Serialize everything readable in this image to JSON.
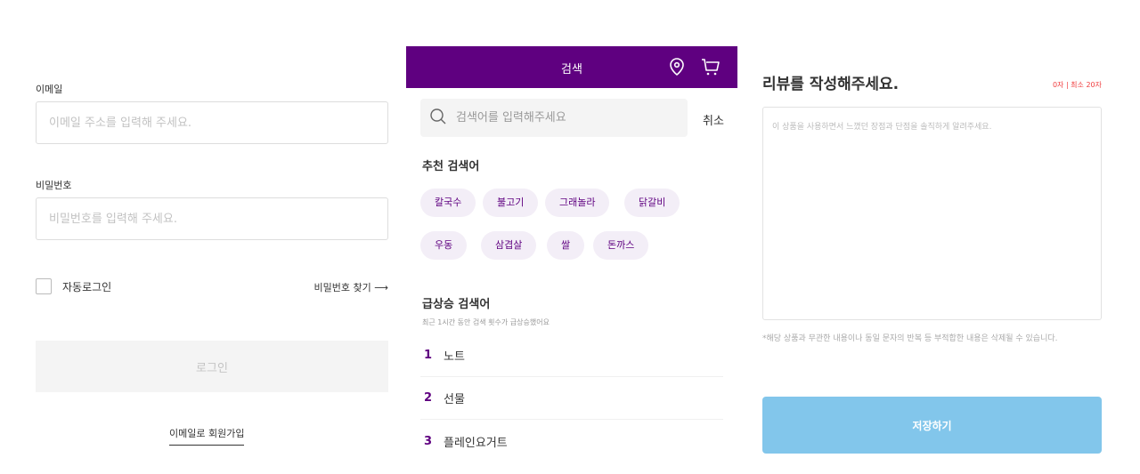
{
  "login": {
    "email_label": "이메일",
    "email_placeholder": "이메일 주소를 입력해 주세요.",
    "password_label": "비밀번호",
    "password_placeholder": "비밀번호를 입력해 주세요.",
    "auto_login_label": "자동로그인",
    "find_password_link": "비밀번호 찾기 ⟶",
    "login_button": "로그인",
    "signup_link": "이메일로 회원가입"
  },
  "search": {
    "header_title": "검색",
    "header_icons": [
      "location-pin-icon",
      "cart-icon"
    ],
    "accent_color": "#5f0080",
    "input_placeholder": "검색어를 입력해주세요",
    "cancel_label": "취소",
    "recommended_title": "추천 검색어",
    "recommended_chips": [
      "칼국수",
      "불고기",
      "그래놀라",
      "닭갈비",
      "우동",
      "삼겹살",
      "쌀",
      "돈까스"
    ],
    "trending_title": "급상승 검색어",
    "trending_subtitle": "최근 1시간 동안 검색 횟수가 급상승했어요",
    "trending": [
      {
        "rank": "1",
        "term": "노트"
      },
      {
        "rank": "2",
        "term": "선물"
      },
      {
        "rank": "3",
        "term": "플레인요거트"
      }
    ]
  },
  "review": {
    "title": "리뷰를 작성해주세요.",
    "char_count": "0자 | 최소 20자",
    "placeholder": "이 상품을 사용하면서 느꼈던 장점과 단점을 솔직하게 알려주세요.",
    "note": "*해당 상품과 무관한 내용이나 동일 문자의 반복 등 부적합한 내용은 삭제될 수 있습니다.",
    "save_button": "저장하기",
    "save_button_color": "#82c6eb"
  }
}
